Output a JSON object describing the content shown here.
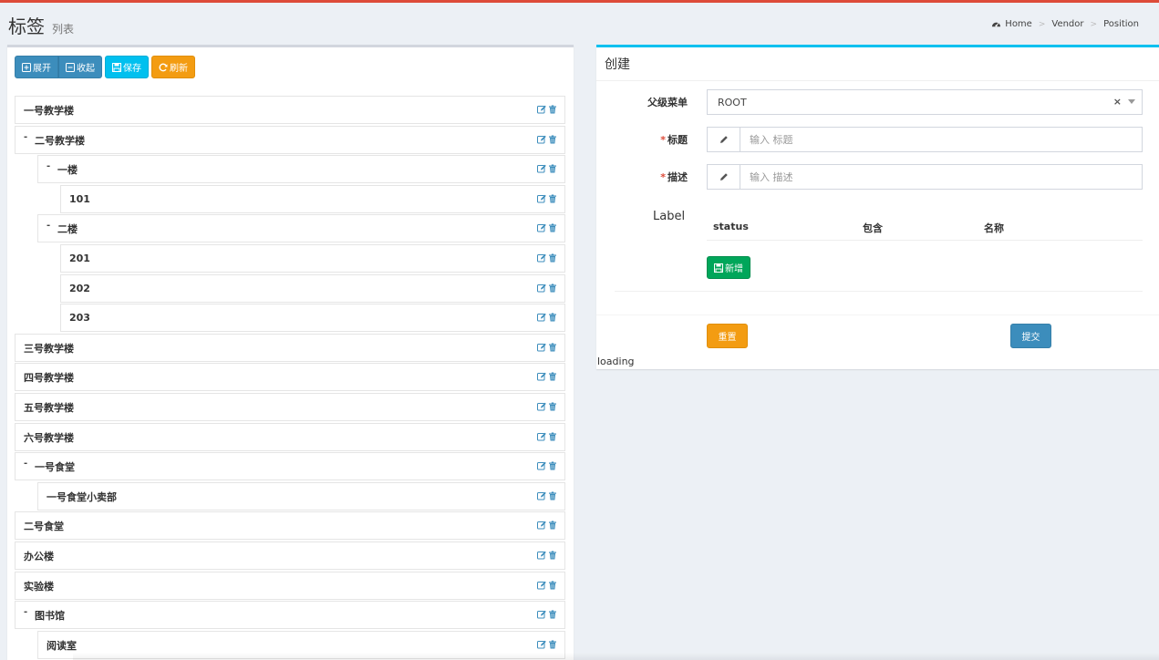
{
  "page": {
    "title": "标签",
    "subtitle": "列表"
  },
  "breadcrumb": {
    "home": "Home",
    "vendor": "Vendor",
    "position": "Position"
  },
  "toolbar": {
    "expand": "展开",
    "collapse": "收起",
    "save": "保存",
    "refresh": "刷新"
  },
  "tree": [
    {
      "label": "一号教学楼",
      "level": 0,
      "expanded": false
    },
    {
      "label": "二号教学楼",
      "level": 0,
      "expanded": true
    },
    {
      "label": "一楼",
      "level": 1,
      "expanded": true
    },
    {
      "label": "101",
      "level": 2,
      "expanded": false
    },
    {
      "label": "二楼",
      "level": 1,
      "expanded": true
    },
    {
      "label": "201",
      "level": 2,
      "expanded": false
    },
    {
      "label": "202",
      "level": 2,
      "expanded": false
    },
    {
      "label": "203",
      "level": 2,
      "expanded": false
    },
    {
      "label": "三号教学楼",
      "level": 0,
      "expanded": false
    },
    {
      "label": "四号教学楼",
      "level": 0,
      "expanded": false
    },
    {
      "label": "五号教学楼",
      "level": 0,
      "expanded": false
    },
    {
      "label": "六号教学楼",
      "level": 0,
      "expanded": false
    },
    {
      "label": "一号食堂",
      "level": 0,
      "expanded": true
    },
    {
      "label": "一号食堂小卖部",
      "level": 1,
      "expanded": false
    },
    {
      "label": "二号食堂",
      "level": 0,
      "expanded": false
    },
    {
      "label": "办公楼",
      "level": 0,
      "expanded": false
    },
    {
      "label": "实验楼",
      "level": 0,
      "expanded": false
    },
    {
      "label": "图书馆",
      "level": 0,
      "expanded": true
    },
    {
      "label": "阅读室",
      "level": 1,
      "expanded": false
    }
  ],
  "form": {
    "title": "创建",
    "parent_label": "父级菜单",
    "parent_value": "ROOT",
    "title_label": "标题",
    "title_placeholder": "输入 标题",
    "desc_label": "描述",
    "desc_placeholder": "输入 描述",
    "label_section": "Label",
    "columns": [
      "status",
      "包含",
      "名称"
    ],
    "add_button": "新增",
    "reset_button": "重置",
    "submit_button": "提交",
    "required_mark": "*"
  },
  "loading_text": "loading",
  "colors": {
    "primary": "#3c8dbc",
    "info": "#00c0ef",
    "warning": "#f39c12",
    "success": "#00a65a",
    "danger": "#dd4b39"
  }
}
